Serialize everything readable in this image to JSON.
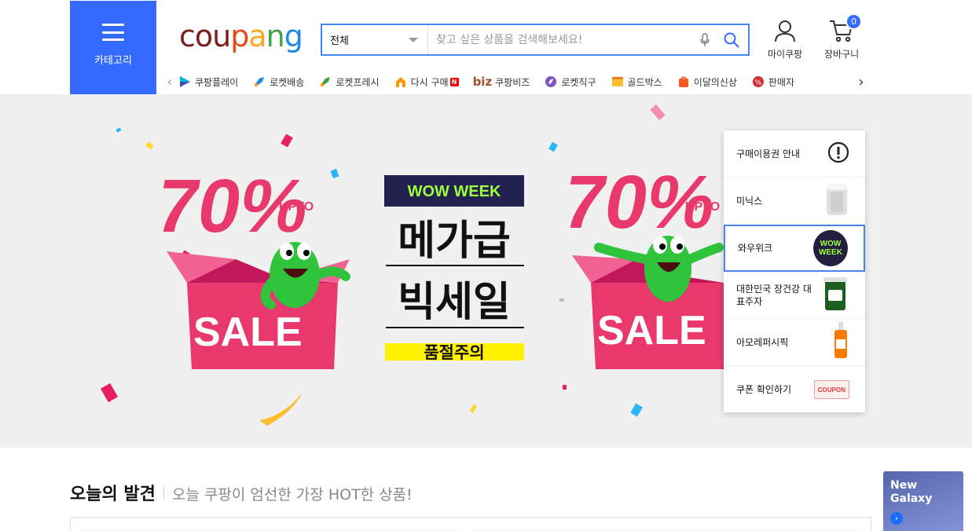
{
  "colors": {
    "brand_blue": "#346aff",
    "search_border": "#4285f4",
    "banner_bg": "#f0f0f0",
    "sale_pink": "#e8386c",
    "wow_green": "#2fc43b"
  },
  "header": {
    "category_label": "카테고리",
    "logo": {
      "letters": [
        "c",
        "o",
        "u",
        "p",
        "a",
        "n",
        "g"
      ],
      "letter_colors": [
        "#7a1f1f",
        "#7a1f1f",
        "#7a1f1f",
        "#e64a19",
        "#f9a825",
        "#43a047",
        "#1e88e5"
      ]
    },
    "search": {
      "category": "전체",
      "placeholder": "찾고 싶은 상품을 검색해보세요!",
      "mic_icon": "mic-icon",
      "search_icon": "search-icon"
    },
    "my_coupang": "마이쿠팡",
    "cart_label": "장바구니",
    "cart_count": "0"
  },
  "shortcuts": [
    {
      "label": "쿠팡플레이",
      "icon": "play-icon"
    },
    {
      "label": "로켓배송",
      "icon": "rocket-icon"
    },
    {
      "label": "로켓프레시",
      "icon": "rocket-fresh-icon"
    },
    {
      "label": "다시 구매",
      "icon": "rebuy-icon",
      "badge": "N"
    },
    {
      "label": "쿠팡비즈",
      "icon": "biz-icon",
      "prefix": "biz"
    },
    {
      "label": "로켓직구",
      "icon": "rocket-direct-icon"
    },
    {
      "label": "골드박스",
      "icon": "gold-box-icon"
    },
    {
      "label": "이달의신상",
      "icon": "new-icon"
    },
    {
      "label": "판매자",
      "icon": "seller-icon"
    }
  ],
  "banner": {
    "badge": "WOW WEEK",
    "line1": "메가급",
    "line2": "빅세일",
    "tag": "품절주의",
    "upto": "UPTO",
    "percent": "70%",
    "sale": "SALE"
  },
  "side_panel": [
    {
      "label": "구매이용권 안내",
      "icon": "info-icon"
    },
    {
      "label": "미닉스",
      "icon": "appliance-icon"
    },
    {
      "label": "와우위크",
      "icon": "wow-week-icon",
      "active": true
    },
    {
      "label": "대한민국 장건강 대표주자",
      "icon": "yogurt-icon"
    },
    {
      "label": "아모레퍼시픽",
      "icon": "serum-bottle-icon"
    },
    {
      "label": "쿠폰 확인하기",
      "icon": "coupon-icon",
      "coupon_text": "COUPON"
    }
  ],
  "section": {
    "title": "오늘의 발견",
    "subtitle": "오늘 쿠팡이 엄선한 가장 HOT한 상품!"
  },
  "ad": {
    "line1": "New",
    "line2": "Galaxy"
  },
  "wow_week_logo": {
    "line1": "WOW",
    "line2": "WEEK"
  }
}
